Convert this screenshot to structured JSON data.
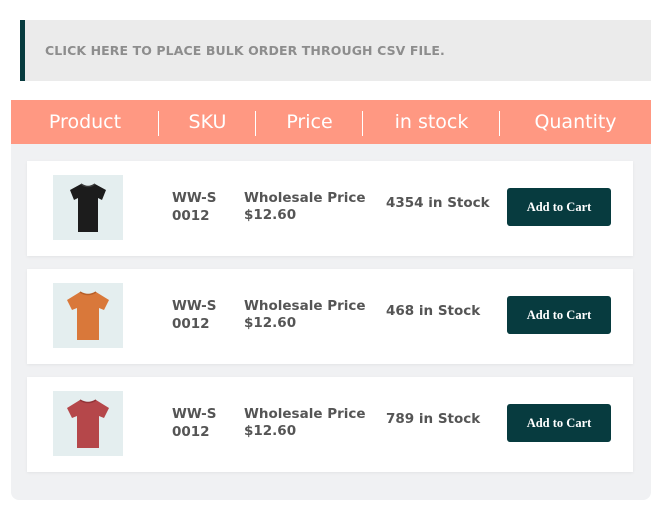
{
  "bulk_order": {
    "label": "CLICK HERE TO PLACE BULK ORDER THROUGH CSV FILE."
  },
  "table": {
    "headers": [
      "Product",
      "SKU",
      "Price",
      "in stock",
      "Quantity"
    ],
    "rows": [
      {
        "product_icon": "black-tshirt-icon",
        "sku_line1": "WW-S",
        "sku_line2": "0012",
        "price_line1": "Wholesale Price",
        "price_line2": "$12.60",
        "stock": "4354 in Stock",
        "button": "Add to Cart"
      },
      {
        "product_icon": "orange-tshirt-icon",
        "sku_line1": "WW-S",
        "sku_line2": "0012",
        "price_line1": "Wholesale Price",
        "price_line2": "$12.60",
        "stock": "468 in Stock",
        "button": "Add to Cart"
      },
      {
        "product_icon": "red-tshirt-icon",
        "sku_line1": "WW-S",
        "sku_line2": "0012",
        "price_line1": "Wholesale Price",
        "price_line2": "$12.60",
        "stock": "789 in Stock",
        "button": "Add to Cart"
      }
    ]
  },
  "colors": {
    "header_bg": "#ff9882",
    "accent_dark": "#073b3f",
    "tshirt_black": "#1c1c1c",
    "tshirt_orange": "#d9783a",
    "tshirt_red": "#b5474a"
  }
}
